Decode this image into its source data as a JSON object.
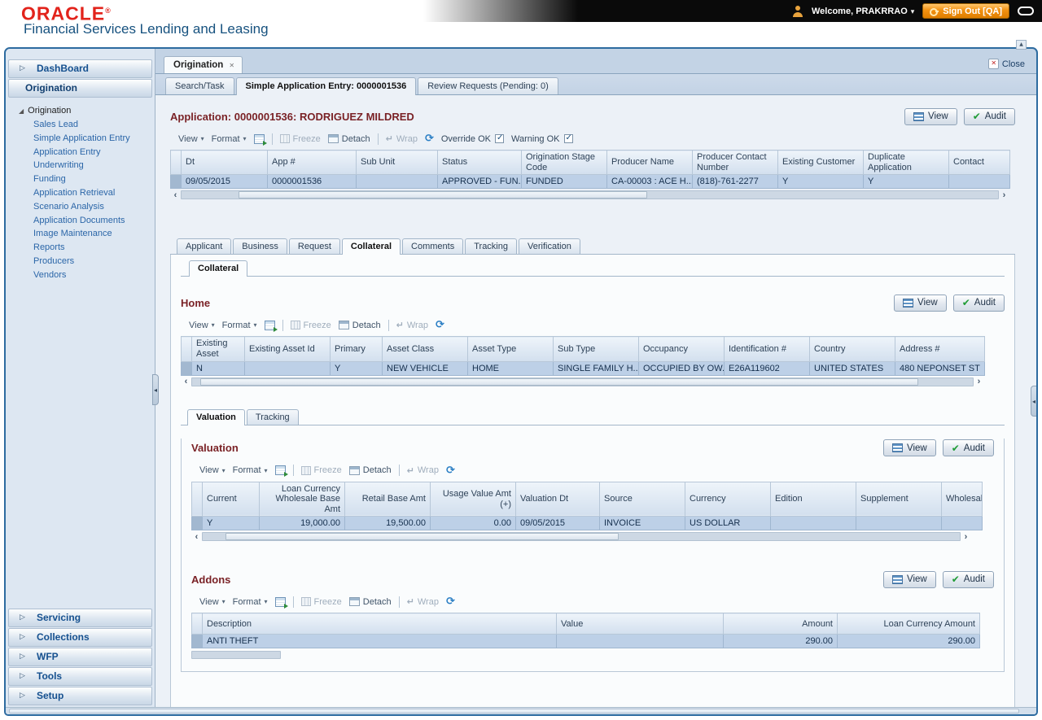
{
  "header": {
    "logo": "ORACLE",
    "app_title": "Financial Services Lending and Leasing",
    "welcome": "Welcome, PRAKRRAO",
    "sign_out": "Sign Out [QA]"
  },
  "sidebar": {
    "dashboard": "DashBoard",
    "origination": "Origination",
    "tree_root": "Origination",
    "tree_items": [
      "Sales Lead",
      "Simple Application Entry",
      "Application Entry",
      "Underwriting",
      "Funding",
      "Application Retrieval",
      "Scenario Analysis",
      "Application Documents",
      "Image Maintenance",
      "Reports",
      "Producers",
      "Vendors"
    ],
    "bottom_sections": [
      "Servicing",
      "Collections",
      "WFP",
      "Tools",
      "Setup"
    ]
  },
  "window": {
    "tab_label": "Origination",
    "close_label": "Close"
  },
  "tabs": {
    "items": [
      "Search/Task",
      "Simple Application Entry: 0000001536",
      "Review Requests (Pending: 0)"
    ],
    "active": 1
  },
  "subtabs": {
    "items": [
      "Applicant",
      "Business",
      "Request",
      "Collateral",
      "Comments",
      "Tracking",
      "Verification"
    ],
    "active": 3
  },
  "collateral_tab_label": "Collateral",
  "valuation_tabs": {
    "items": [
      "Valuation",
      "Tracking"
    ],
    "active": 0
  },
  "buttons": {
    "view": "View",
    "audit": "Audit"
  },
  "toolbar": {
    "view": "View",
    "format": "Format",
    "freeze": "Freeze",
    "detach": "Detach",
    "wrap": "Wrap",
    "override_ok": "Override OK",
    "warning_ok": "Warning OK",
    "icons": [
      "export-icon",
      "refresh-icon"
    ]
  },
  "sections": {
    "application": "Application: 0000001536: RODRIGUEZ MILDRED",
    "home": "Home",
    "valuation": "Valuation",
    "addons": "Addons"
  },
  "tables": {
    "application": {
      "columns": [
        "Dt",
        "App #",
        "Sub Unit",
        "Status",
        "Origination Stage Code",
        "Producer Name",
        "Producer Contact Number",
        "Existing Customer",
        "Duplicate Application",
        "Contact"
      ],
      "rows": [
        [
          "09/05/2015",
          "0000001536",
          "",
          "APPROVED - FUN...",
          "FUNDED",
          "CA-00003 : ACE H...",
          "(818)-761-2277",
          "Y",
          "Y",
          ""
        ]
      ],
      "numeric": []
    },
    "home": {
      "columns": [
        "Existing Asset",
        "Existing Asset Id",
        "Primary",
        "Asset Class",
        "Asset Type",
        "Sub Type",
        "Occupancy",
        "Identification #",
        "Country",
        "Address #"
      ],
      "rows": [
        [
          "N",
          "",
          "Y",
          "NEW VEHICLE",
          "HOME",
          "SINGLE FAMILY H...",
          "OCCUPIED BY OW...",
          "E26A119602",
          "UNITED STATES",
          "480 NEPONSET ST"
        ]
      ],
      "numeric": []
    },
    "valuation": {
      "columns": [
        "Current",
        "Loan Currency Wholesale Base Amt",
        "Retail Base Amt",
        "Usage Value Amt (+)",
        "Valuation Dt",
        "Source",
        "Currency",
        "Edition",
        "Supplement",
        "Wholesale"
      ],
      "rows": [
        [
          "Y",
          "19,000.00",
          "19,500.00",
          "0.00",
          "09/05/2015",
          "INVOICE",
          "US DOLLAR",
          "",
          "",
          ""
        ]
      ],
      "numeric": [
        1,
        2,
        3
      ]
    },
    "addons": {
      "columns": [
        "Description",
        "Value",
        "Amount",
        "Loan Currency Amount"
      ],
      "rows": [
        [
          "ANTI THEFT",
          "",
          "290.00",
          "290.00"
        ]
      ],
      "numeric": [
        2,
        3
      ]
    }
  }
}
